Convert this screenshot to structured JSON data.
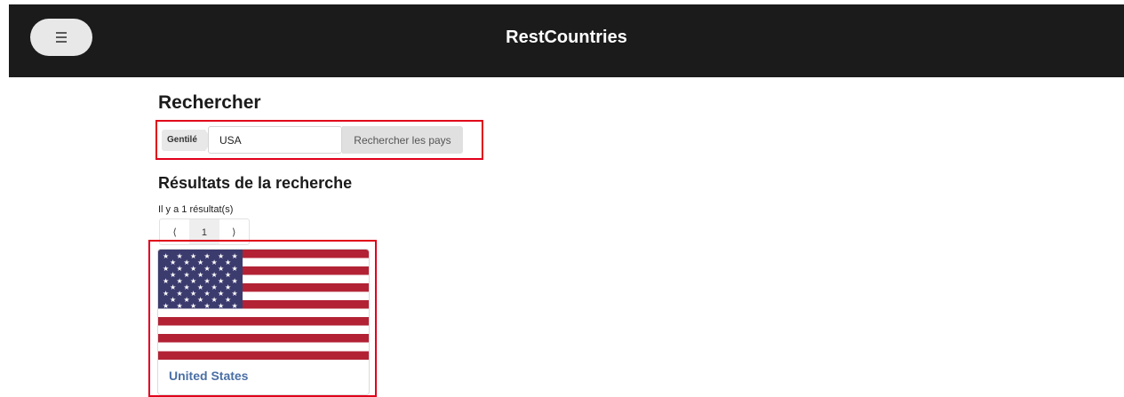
{
  "header": {
    "app_title": "RestCountries",
    "menu_icon": "hamburger-icon"
  },
  "search": {
    "heading": "Rechercher",
    "filter_label": "Gentilé",
    "input_value": "USA",
    "button_label": "Rechercher les pays"
  },
  "results": {
    "heading": "Résultats de la recherche",
    "count_text": "Il y a 1 résultat(s)",
    "pagination": {
      "prev": "⟨",
      "page": "1",
      "next": "⟩"
    },
    "items": [
      {
        "name": "United States",
        "flag": "us-flag"
      }
    ]
  }
}
